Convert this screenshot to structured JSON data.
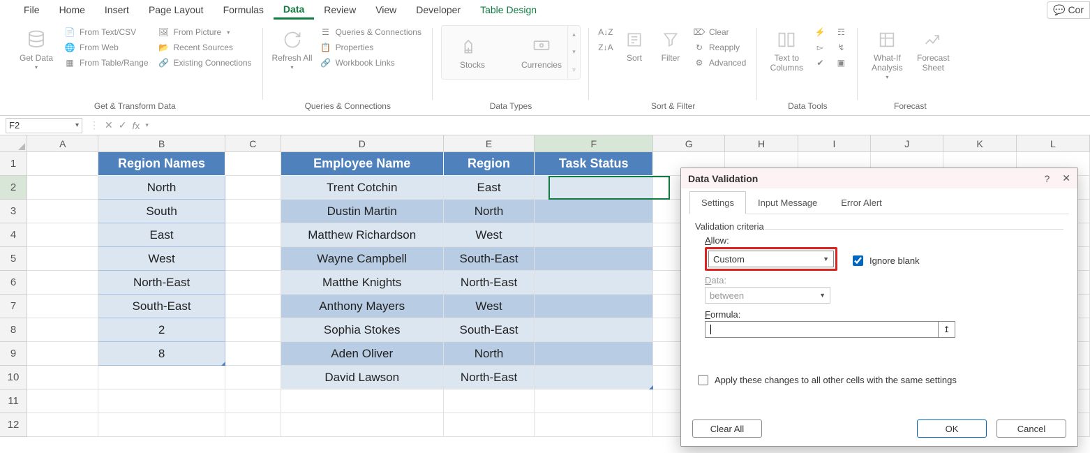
{
  "menubar": {
    "items": [
      "File",
      "Home",
      "Insert",
      "Page Layout",
      "Formulas",
      "Data",
      "Review",
      "View",
      "Developer"
    ],
    "contextual": "Table Design",
    "active_index": 5,
    "comments_label": "Cor"
  },
  "ribbon": {
    "groups": {
      "get_transform": {
        "label": "Get & Transform Data",
        "get_data": "Get Data",
        "from_text_csv": "From Text/CSV",
        "from_web": "From Web",
        "from_table_range": "From Table/Range",
        "from_picture": "From Picture",
        "recent_sources": "Recent Sources",
        "existing_connections": "Existing Connections"
      },
      "queries": {
        "label": "Queries & Connections",
        "refresh_all": "Refresh All",
        "queries_connections": "Queries & Connections",
        "properties": "Properties",
        "workbook_links": "Workbook Links"
      },
      "data_types": {
        "label": "Data Types",
        "stocks": "Stocks",
        "currencies": "Currencies"
      },
      "sort_filter": {
        "label": "Sort & Filter",
        "sort": "Sort",
        "filter": "Filter",
        "clear": "Clear",
        "reapply": "Reapply",
        "advanced": "Advanced"
      },
      "data_tools": {
        "label": "Data Tools",
        "text_to_columns": "Text to Columns"
      },
      "forecast": {
        "label": "Forecast",
        "what_if": "What-If Analysis",
        "forecast_sheet": "Forecast Sheet"
      }
    }
  },
  "formula_bar": {
    "name_box": "F2",
    "formula": ""
  },
  "grid": {
    "columns": [
      "A",
      "B",
      "C",
      "D",
      "E",
      "F",
      "G",
      "H",
      "I",
      "J",
      "K",
      "L"
    ],
    "rows": [
      "1",
      "2",
      "3",
      "4",
      "5",
      "6",
      "7",
      "8",
      "9",
      "10",
      "11",
      "12"
    ],
    "selected_col": "F",
    "selected_row": "2",
    "headers": {
      "B": "Region Names",
      "D": "Employee Name",
      "E": "Region",
      "F": "Task Status"
    },
    "dataB": [
      "North",
      "South",
      "East",
      "West",
      "North-East",
      "South-East",
      "2",
      "8"
    ],
    "dataD": [
      "Trent Cotchin",
      "Dustin Martin",
      "Matthew Richardson",
      "Wayne Campbell",
      "Matthe Knights",
      "Anthony Mayers",
      "Sophia Stokes",
      "Aden Oliver",
      "David Lawson"
    ],
    "dataE": [
      "East",
      "North",
      "West",
      "South-East",
      "North-East",
      "West",
      "South-East",
      "North",
      "North-East"
    ]
  },
  "dialog": {
    "title": "Data Validation",
    "help": "?",
    "close": "✕",
    "tabs": [
      "Settings",
      "Input Message",
      "Error Alert"
    ],
    "active_tab": 0,
    "criteria_label": "Validation criteria",
    "allow_label": "Allow:",
    "allow_value": "Custom",
    "ignore_blank_label": "Ignore blank",
    "ignore_blank_checked": true,
    "data_label": "Data:",
    "data_value": "between",
    "formula_label": "Formula:",
    "formula_value": "",
    "apply_label": "Apply these changes to all other cells with the same settings",
    "apply_checked": false,
    "clear_all": "Clear All",
    "ok": "OK",
    "cancel": "Cancel"
  }
}
